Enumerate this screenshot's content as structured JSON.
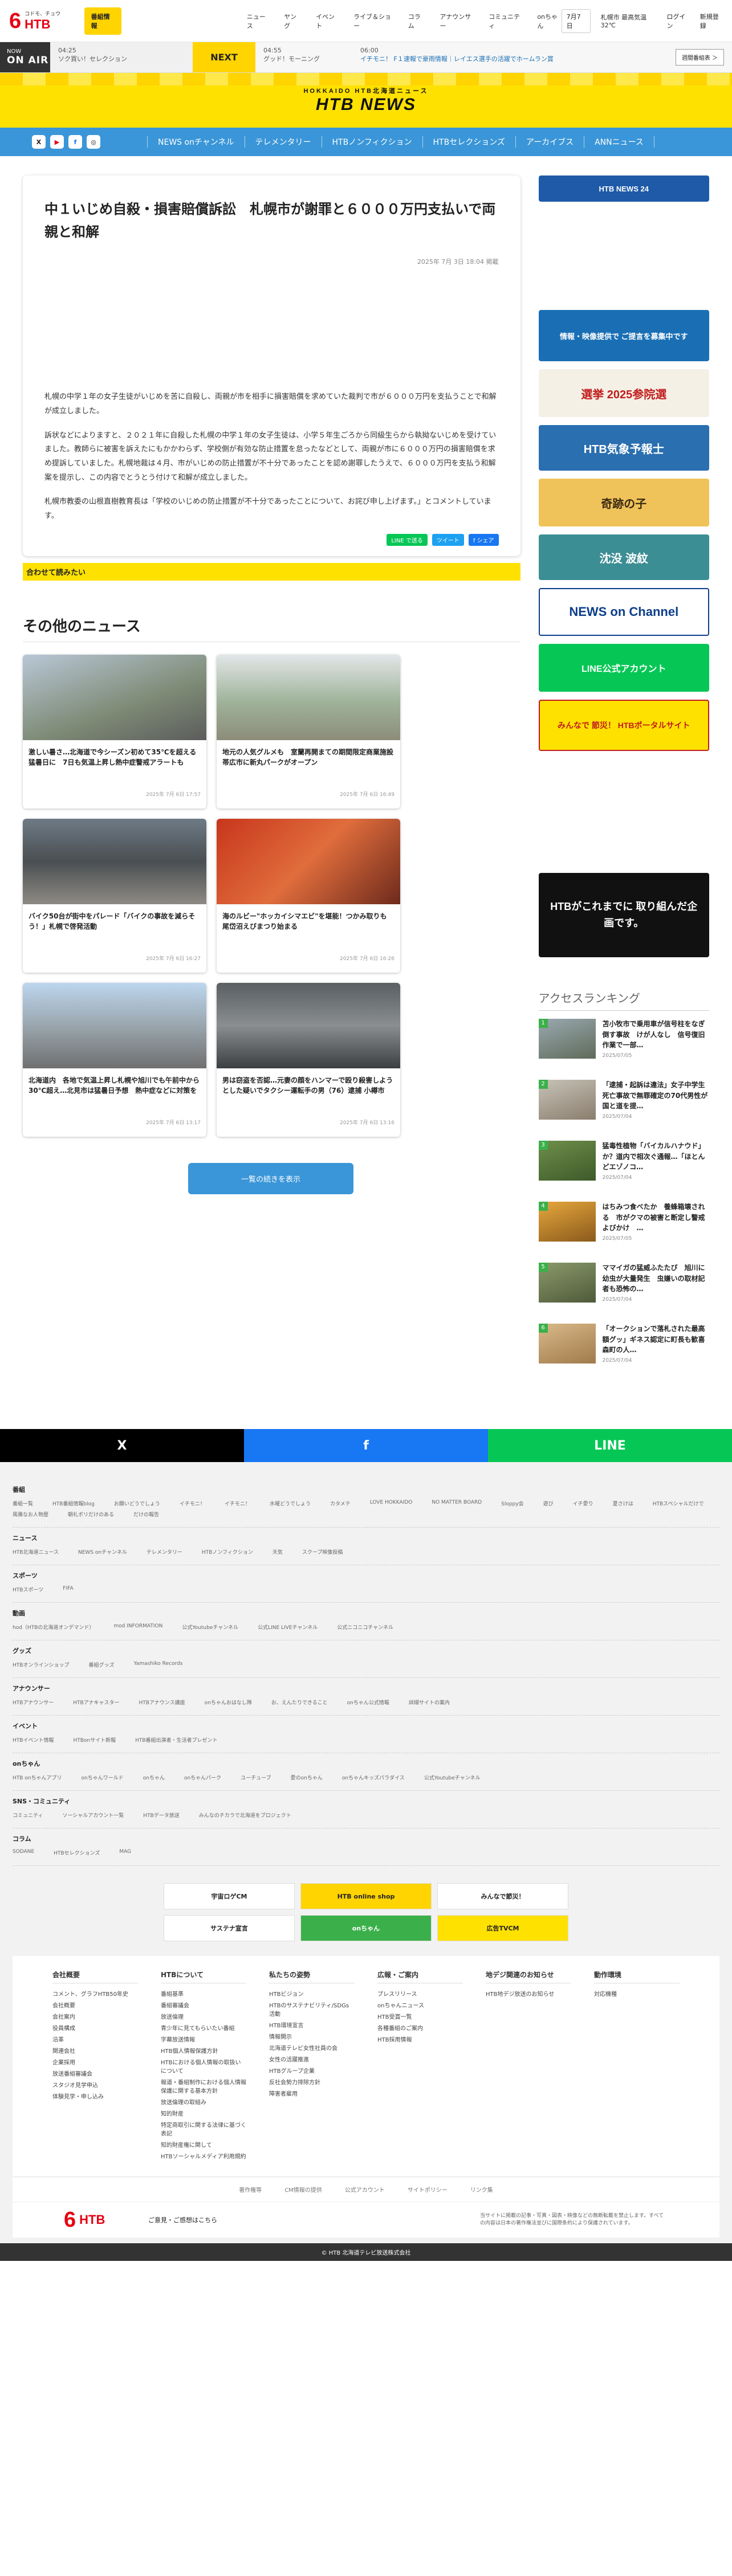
{
  "header": {
    "logo_num": "6",
    "logo_text": "HTB",
    "logo_sub": "コドモ、チュウ",
    "bango_button": "番組情報",
    "nav": [
      "ニュース",
      "ヤング",
      "イベント",
      "ライブ＆ショー",
      "コラム",
      "アナウンサー",
      "コミュニティ",
      "onちゃん"
    ],
    "date": "7月7日",
    "weather": "札幌市 最高気温32℃",
    "login": "ログイン",
    "register": "新規登録"
  },
  "onair": {
    "now_label": "NOW",
    "onair_label": "ON AIR",
    "now_time": "04:25",
    "now_title": "ソク買い！セレクション",
    "next_label": "NEXT",
    "next_time": "04:55",
    "next_title": "グッド！モーニング",
    "ticker_time": "06:00",
    "ticker": "イチモニ！ F１速報で豪雨情報｜レイエス選手の活躍でホームラン賞",
    "bangumi": "週間番組表 ＞"
  },
  "banner": {
    "line1": "HOKKAIDO HTB北海道ニュース",
    "line2": "HTB NEWS"
  },
  "subnav": {
    "social": [
      "X",
      "▶",
      "f",
      "◎"
    ],
    "links": [
      "NEWS onチャンネル",
      "テレメンタリー",
      "HTBノンフィクション",
      "HTBセレクションズ",
      "アーカイブス",
      "ANNニュース"
    ]
  },
  "article": {
    "title": "中１いじめ自殺・損害賠償訴訟　札幌市が謝罪と６０００万円支払いで両親と和解",
    "date": "2025年 7月 3日 18:04 掲載",
    "paragraphs": [
      "札幌の中学１年の女子生徒がいじめを苦に自殺し、両親が市を相手に損害賠償を求めていた裁判で市が６０００万円を支払うことで和解が成立しました。",
      "訴状などによりますと、２０２１年に自殺した札幌の中学１年の女子生徒は、小学５年生ごろから同級生らから執拗ないじめを受けていました。教師らに被害を訴えたにもかかわらず、学校側が有効な防止措置を怠ったなどとして、両親が市に６０００万円の損害賠償を求め提訴していました。札幌地裁は４月、市がいじめの防止措置が不十分であったことを認め謝罪したうえで、６０００万円を支払う和解案を提示し、この内容でとうとう付けて和解が成立しました。",
      "札幌市教委の山根直樹教育長は「学校のいじめの防止措置が不十分であったことについて、お詫び申し上げます。」とコメントしています。"
    ],
    "share": [
      "LINE で送る",
      "ツイート",
      "f シェア"
    ],
    "related": "合わせて読みたい"
  },
  "side_banners": [
    "HTB NEWS 24",
    "情報・映像提供で ご提言を募集中です",
    "選挙 2025参院選",
    "HTB気象予報士",
    "奇跡の子",
    "沈没 波紋",
    "NEWS on Channel",
    "LINE公式アカウント",
    "みんなで 節災！ HTBポータルサイト"
  ],
  "other": {
    "title": "その他のニュース",
    "cards": [
      {
        "title": "激しい暑さ…北海道で今シーズン初めて35℃を超える猛暑日に　7日も気温上昇し熱中症警戒アラートも",
        "date": "2025年 7月 6日 17:57"
      },
      {
        "title": "地元の人気グルメも　室蘭再開まての期間限定商業施設　帯広市に新丸パークがオープン",
        "date": "2025年 7月 6日 16:49"
      },
      {
        "title": "バイク50台が街中をパレード「バイクの事故を減らそう！」札幌で啓発活動",
        "date": "2025年 7月 6日 16:27"
      },
      {
        "title": "海のルビー\"ホッカイシマエビ\"を堪能！つかみ取りも　尾岱沼えびまつり始まる",
        "date": "2025年 7月 6日 16:26"
      },
      {
        "title": "北海道内　各地で気温上昇し札幌や旭川でも午前中から30℃超え…北見市は猛暑日予想　熱中症などに対策を",
        "date": "2025年 7月 6日 13:17"
      },
      {
        "title": "男は窃盗を否認…元妻の顔をハンマーで殴り殺害しようとした疑いでタクシー運転手の男（76）逮捕 小樽市",
        "date": "2025年 7月 6日 13:16"
      }
    ],
    "more": "一覧の続きを表示"
  },
  "ranking": {
    "promo": "HTBがこれまでに 取り組んだ企画です。",
    "title": "アクセスランキング",
    "items": [
      {
        "n": "1",
        "title": "苫小牧市で乗用車が信号柱をなぎ倒す事故　けが人なし　信号復旧作業で一部…",
        "date": "2025/07/05"
      },
      {
        "n": "2",
        "title": "「逮捕・起訴は違法」女子中学生死亡事故で無罪確定の70代男性が国と道を提…",
        "date": "2025/07/04"
      },
      {
        "n": "3",
        "title": "猛毒性植物「バイカルハナウド」か？道内で相次ぐ通報…「ほとんどエゾノコ…",
        "date": "2025/07/04"
      },
      {
        "n": "4",
        "title": "はちみつ食べたか　養蜂箱壊される　市がクマの被害と断定し警戒よびかけ　…",
        "date": "2025/07/05"
      },
      {
        "n": "5",
        "title": "ママイガの猛威ふたたび　旭川に幼虫が大量発生　虫嫌いの取材記者も恐怖の…",
        "date": "2025/07/04"
      },
      {
        "n": "6",
        "title": "「オークションで落札された最高額グッ」ギネス認定に町長も歓喜　森町の人…",
        "date": "2025/07/04"
      }
    ]
  },
  "sharebar": [
    "X",
    "f",
    "LINE"
  ],
  "footer": {
    "sections": [
      {
        "h": "番組",
        "items": [
          "番組一覧",
          "HTB番組情報blog",
          "お願いどうでしょう",
          "イチモニ！",
          "イチモニ！",
          "水曜どうでしょう",
          "カタメテ",
          "LOVE HOKKAIDO",
          "NO MATTER BOARD",
          "Sloppy会",
          "遊び",
          "イチ愛り",
          "夏さけは",
          "HTBスペシャルだけで",
          "風雅なお人物歴",
          "朝礼ボリだけのある",
          "だけの報告"
        ]
      },
      {
        "h": "ニュース",
        "items": [
          "HTB北海道ニュース",
          "NEWS onチャンネル",
          "テレメンタリー",
          "HTBノンフィクション",
          "天気",
          "スクープ映像投稿"
        ]
      },
      {
        "h": "スポーツ",
        "items": [
          "HTBスポーツ",
          "FIFA"
        ]
      },
      {
        "h": "動画",
        "items": [
          "hod（HTBの北海道オンデマンド）",
          "mod INFORMATION",
          "公式Youtubeチャンネル",
          "公式LINE LIVEチャンネル",
          "公式ニコニコチャンネル"
        ]
      },
      {
        "h": "グッズ",
        "items": [
          "HTBオンラインショップ",
          "番組グッズ",
          "Yamashiko Records"
        ]
      },
      {
        "h": "アナウンサー",
        "items": [
          "HTBアナウンサー",
          "HTBアナキャスター",
          "HTBアナウンス講座",
          "onちゃんおはなし隊",
          "お、えんたりできること",
          "onちゃん公式情報",
          "詳細サイトの案内"
        ]
      },
      {
        "h": "イベント",
        "items": [
          "HTBイベント情報",
          "HTBonサイト新報",
          "HTB番組出演者・生活者プレゼント"
        ]
      },
      {
        "h": "onちゃん",
        "items": [
          "HTB onちゃんアプリ",
          "onちゃんワールド",
          "onちゃん",
          "onちゃんパーク",
          "ユーチューブ",
          "愛のonちゃん",
          "onちゃんキッズパラダイス",
          "公式Youtubeチャンネル"
        ]
      },
      {
        "h": "SNS・コミュニティ",
        "items": [
          "コミュニティ",
          "ソーシャルアカウント一覧",
          "HTBデータ放送",
          "みんなのチカラで北海道をプロジェクト"
        ]
      },
      {
        "h": "コラム",
        "items": [
          "SODANE",
          "HTBセレクションズ",
          "MAG"
        ]
      }
    ],
    "banners": [
      "宇宙ロゲCM",
      "HTB online shop",
      "みんなで節災！",
      "サステナ宣言",
      "onちゃん",
      "広告TVCM"
    ],
    "cols": [
      {
        "h": "会社概要",
        "items": [
          "コメント、グラフHTB50年史",
          "会社概要",
          "会社案内",
          "役員構成",
          "沿革",
          "関連会社",
          "企業採用",
          "放送番組審議会",
          "スタジオ見学申込",
          "体験見学・申し込み"
        ]
      },
      {
        "h": "HTBについて",
        "items": [
          "番組基準",
          "番組審議会",
          "放送倫理",
          "青少年に見てもらいたい番組",
          "字幕放送情報",
          "HTB個人情報保護方針",
          "HTBにおける個人情報の取扱いについて",
          "報道・番組制作における個人情報保護に関する基本方針",
          "放送倫理の取組み",
          "知的財産",
          "特定商取引に関する法律に基づく表記",
          "知的財産権に関して",
          "HTBソーシャルメディア利用規約"
        ]
      },
      {
        "h": "私たちの姿勢",
        "items": [
          "HTBビジョン",
          "HTBのサステナビリティ/SDGs活動",
          "HTB環境宣言",
          "情報開示",
          "北海道テレビ女性社員の会",
          "女性の活躍推進",
          "HTBグループ企業",
          "反社会勢力排除方針",
          "障害者雇用"
        ]
      },
      {
        "h": "広報・ご案内",
        "items": [
          "プレスリリース",
          "onちゃんニュース",
          "HTB受賞一覧",
          "各種番組のご案内",
          "HTB採用情報"
        ]
      },
      {
        "h": "地デジ関連のお知らせ",
        "items": [
          "HTB地デジ放送のお知らせ"
        ]
      },
      {
        "h": "動作環境",
        "items": [
          "対応機種"
        ]
      }
    ],
    "legal": [
      "著作権等",
      "CM情報の提供",
      "公式アカウント",
      "サイトポリシー",
      "リンク集"
    ],
    "guide": "ご意見・ご感想はこちら",
    "note": "当サイトに掲載の記事・写真・図表・映像などの無断転載を禁止します。すべての内容は日本の著作権法並びに国際条約により保護されています。",
    "copyright": "© HTB 北海道テレビ放送株式会社"
  },
  "colors": {
    "accent": "#3a96d8",
    "yellow": "#ffe100",
    "red": "#e60012",
    "x": "#000000",
    "facebook": "#1877f2",
    "line": "#06c755"
  }
}
